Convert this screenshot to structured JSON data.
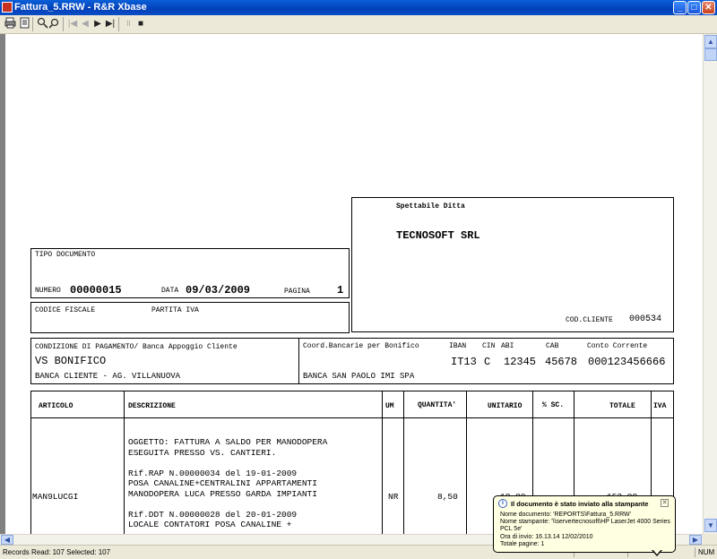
{
  "window": {
    "title": "Fattura_5.RRW - R&R Xbase"
  },
  "toolbar": {
    "buttons": [
      "print-icon",
      "preview-icon",
      "zoom-in-icon",
      "zoom-out-icon",
      "first-page-icon",
      "prev-page-icon",
      "next-page-icon",
      "last-page-icon",
      "pause-icon",
      "stop-icon"
    ]
  },
  "report": {
    "addressee": {
      "label": "Spettabile Ditta",
      "name": "TECNOSOFT SRL",
      "client_code_label": "COD.CLIENTE",
      "client_code": "000534"
    },
    "document": {
      "type_label": "TIPO DOCUMENTO",
      "number_label": "NUMERO",
      "number": "00000015",
      "date_label": "DATA",
      "date": "09/03/2009",
      "page_label": "PAGINA",
      "page": "1"
    },
    "tax": {
      "fiscal_code_label": "CODICE FISCALE",
      "vat_label": "PARTITA IVA"
    },
    "payment": {
      "label": "CONDIZIONE DI PAGAMENTO/ Banca Appoggio Cliente",
      "method": "VS BONIFICO",
      "client_bank": "BANCA CLIENTE - AG. VILLANUOVA",
      "bank_coords_label": "Coord.Bancarie per Bonifico",
      "iban_label": "IBAN",
      "cin_label": "CIN",
      "abi_label": "ABI",
      "cab_label": "CAB",
      "account_label": "Conto Corrente",
      "iban": "IT13",
      "cin": "C",
      "abi": "12345",
      "cab": "45678",
      "account": "000123456666",
      "beneficiary_bank": "BANCA SAN PAOLO IMI SPA"
    },
    "table": {
      "headers": {
        "article": "ARTICOLO",
        "description": "DESCRIZIONE",
        "um": "UM",
        "qty": "QUANTITA'",
        "unit": "UNITARIO",
        "discount": "% SC.",
        "total": "TOTALE",
        "vat": "IVA"
      },
      "row": {
        "article": "MAN9LUCGI",
        "um": "NR",
        "qty": "8,50",
        "unit": "18,00",
        "total": "153,00",
        "description_lines": [
          "OGGETTO: FATTURA A SALDO PER MANODOPERA",
          "ESEGUITA PRESSO VS. CANTIERI.",
          "",
          "Rif.RAP N.00000034 del 19-01-2009",
          "POSA CANALINE+CENTRALINI APPARTAMENTI",
          "MANODOPERA LUCA PRESSO GARDA IMPIANTI",
          "",
          "Rif.DDT N.00000028 del 20-01-2009",
          "LOCALE CONTATORI POSA CANALINE +"
        ]
      }
    }
  },
  "status": {
    "records": "Records Read: 107   Selected: 107",
    "num": "NUM"
  },
  "notification": {
    "title": "Il documento è stato inviato alla stampante",
    "lines": [
      "Nome documento: 'REPORTS\\Fattura_5.RRW'",
      "Nome stampante: '\\\\servertecnosoft\\HP LaserJet 4000 Series",
      "PCL 5e'",
      "Ora di invio: 16.13.14  12/02/2010",
      "Totale pagine: 1"
    ]
  }
}
